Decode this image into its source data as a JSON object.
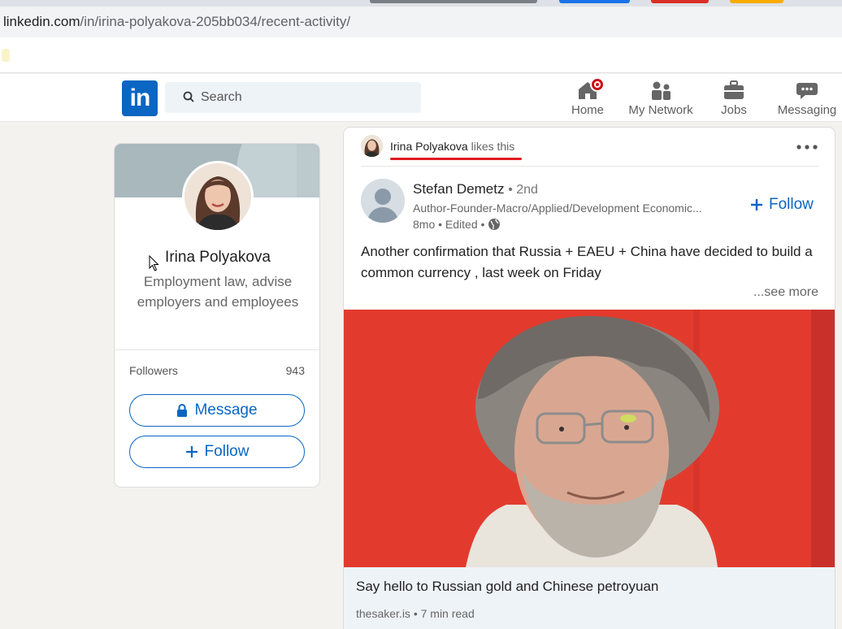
{
  "browser": {
    "url_host": "linkedin.com",
    "url_path": "/in/irina-polyakova-205bb034/recent-activity/"
  },
  "nav": {
    "logo_text": "in",
    "search_placeholder": "Search",
    "items": [
      {
        "label": "Home",
        "icon": "home-icon",
        "has_badge": true
      },
      {
        "label": "My Network",
        "icon": "network-icon"
      },
      {
        "label": "Jobs",
        "icon": "briefcase-icon"
      },
      {
        "label": "Messaging",
        "icon": "messaging-icon"
      }
    ]
  },
  "profile": {
    "name": "Irina Polyakova",
    "headline": "Employment law, advise employers and employees",
    "followers_label": "Followers",
    "followers_count": "943",
    "message_label": "Message",
    "follow_label": "Follow"
  },
  "post": {
    "activity_name": "Irina Polyakova",
    "activity_action": "likes this",
    "author_name": "Stefan Demetz",
    "author_degree": "• 2nd",
    "author_subtitle": "Author-Founder-Macro/Applied/Development Economic...",
    "author_time": "8mo • Edited •",
    "follow_label": "Follow",
    "text": "Another confirmation that Russia + EAEU + China have decided to build a common currency , last week on Friday",
    "see_more": "...see more",
    "link_title": "Say hello to Russian gold and Chinese petroyuan",
    "link_source": "thesaker.is • 7 min read"
  },
  "colors": {
    "brand": "#0a66c2",
    "badge": "#cc1016",
    "highlight_underline": "#e11b22"
  }
}
